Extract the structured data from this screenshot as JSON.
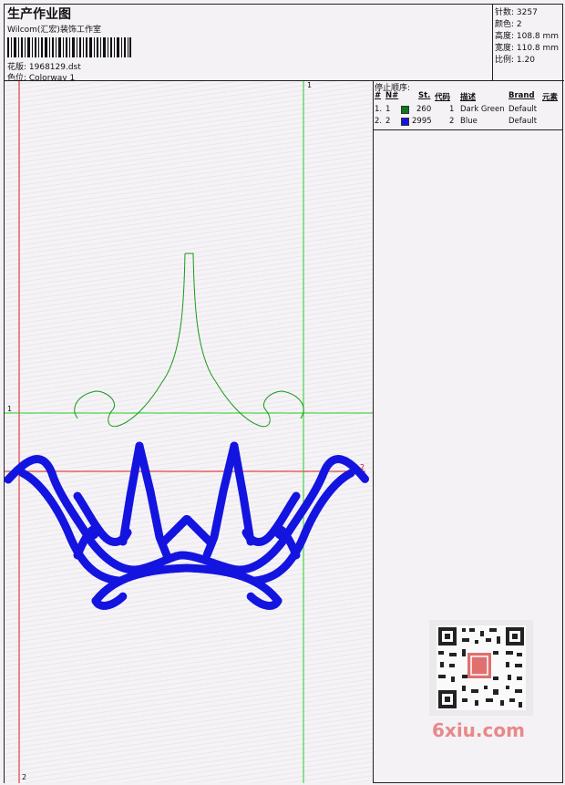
{
  "header": {
    "title": "生产作业图",
    "company": "Wilcom(汇宏)装饰工作室",
    "design_label": "花版: 1968129.dst",
    "colorway_label": "色位: Colorway 1"
  },
  "stats": {
    "stitches": "针数: 3257",
    "colors": "颜色: 2",
    "height": "高度: 108.8 mm",
    "width": "宽度: 110.8 mm",
    "ratio": "比例: 1.20"
  },
  "stop_sequence": {
    "title": "停止顺序:",
    "headers": [
      "#",
      "N#",
      "St.",
      "代码",
      "描述",
      "Brand",
      "元素"
    ],
    "rows": [
      {
        "num": "1.",
        "needle": "1",
        "color": "#0a7a1a",
        "stitches": "260",
        "code": "1",
        "desc": "Dark Green",
        "brand": "Default"
      },
      {
        "num": "2.",
        "needle": "2",
        "color": "#1414e0",
        "stitches": "2995",
        "code": "2",
        "desc": "Blue",
        "brand": "Default"
      }
    ]
  },
  "markers": {
    "green_top": "1",
    "green_left": "1",
    "red_right": "2",
    "red_bottom": "2"
  },
  "watermark": "6xiu.com"
}
